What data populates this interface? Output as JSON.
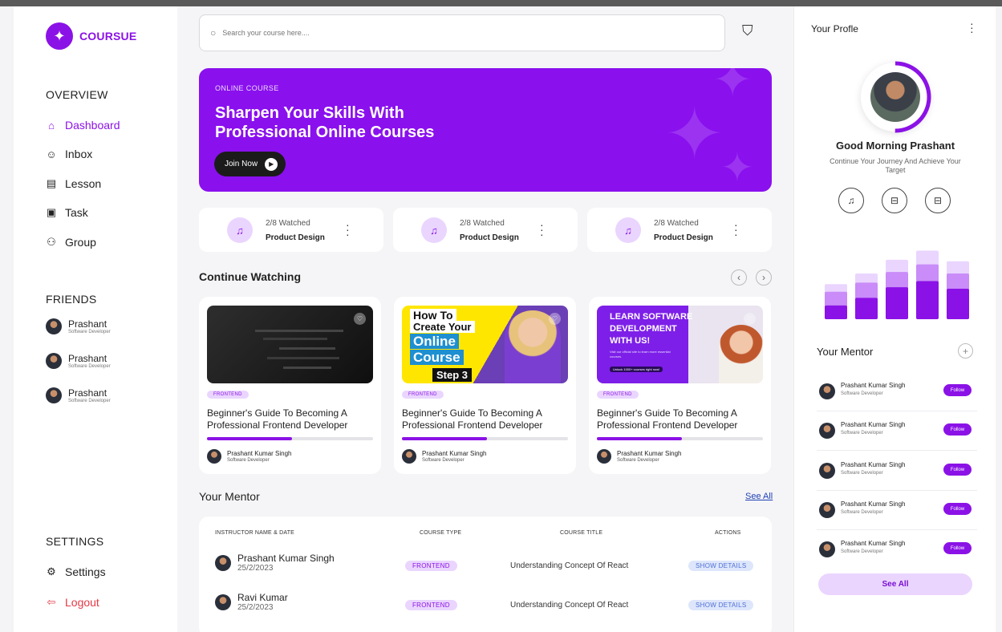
{
  "brand": {
    "name": "COURSUE",
    "accent": "#8b12e6"
  },
  "sidebar": {
    "overview_title": "OVERVIEW",
    "nav": [
      {
        "label": "Dashboard",
        "icon": "home-icon",
        "active": true
      },
      {
        "label": "Inbox",
        "icon": "inbox-icon"
      },
      {
        "label": "Lesson",
        "icon": "lesson-icon"
      },
      {
        "label": "Task",
        "icon": "task-icon"
      },
      {
        "label": "Group",
        "icon": "group-icon"
      }
    ],
    "friends_title": "FRIENDS",
    "friends": [
      {
        "name": "Prashant",
        "role": "Software Developer"
      },
      {
        "name": "Prashant",
        "role": "Software Developer"
      },
      {
        "name": "Prashant",
        "role": "Software Developer"
      }
    ],
    "settings_title": "SETTINGS",
    "settings_label": "Settings",
    "logout_label": "Logout"
  },
  "search": {
    "placeholder": "Search your course here...."
  },
  "hero": {
    "eyebrow": "ONLINE COURSE",
    "headline": "Sharpen  Your Skills With Professional Online Courses",
    "cta": "Join Now"
  },
  "stats": [
    {
      "watched": "2/8 Watched",
      "title": "Product Design"
    },
    {
      "watched": "2/8 Watched",
      "title": "Product Design"
    },
    {
      "watched": "2/8 Watched",
      "title": "Product Design"
    }
  ],
  "continue_watching": {
    "title": "Continue Watching",
    "cards": [
      {
        "tag": "FRONTEND",
        "title": "Beginner's Guide To Becoming A Professional Frontend Developer",
        "progress": 0.51,
        "author": "Prashant Kumar Singh",
        "role": "Software Developer",
        "thumb": "code"
      },
      {
        "tag": "FRONTEND",
        "title": "Beginner's Guide To Becoming A Professional Frontend Developer",
        "progress": 0.51,
        "author": "Prashant Kumar Singh",
        "role": "Software Developer",
        "thumb": "course",
        "thumb_text": [
          "How To",
          "Create Your",
          "Online",
          "Course",
          "Step 3"
        ]
      },
      {
        "tag": "FRONTEND",
        "title": "Beginner's Guide To Becoming A Professional Frontend Developer",
        "progress": 0.51,
        "author": "Prashant Kumar Singh",
        "role": "Software Developer",
        "thumb": "software",
        "thumb_text": [
          "LEARN SOFTWARE",
          "DEVELOPMENT",
          "WITH US!",
          "Visit our official site to learn more essential courses.",
          "Unlock 1000+ courses right now!"
        ]
      }
    ]
  },
  "mentor_table": {
    "title": "Your Mentor",
    "see_all": "See All",
    "headers": [
      "INSTRUCTOR NAME & DATE",
      "COURSE TYPE",
      "COURSE TITLE",
      "ACTIONS"
    ],
    "rows": [
      {
        "name": "Prashant Kumar Singh",
        "date": "25/2/2023",
        "type": "FRONTEND",
        "course": "Understanding Concept Of React",
        "action": "SHOW DETAILS"
      },
      {
        "name": "Ravi Kumar",
        "date": "25/2/2023",
        "type": "FRONTEND",
        "course": "Understanding Concept Of React",
        "action": "SHOW DETAILS"
      }
    ]
  },
  "profile": {
    "title": "Your Profle",
    "greeting": "Good Morning Prashant",
    "subtitle": "Continue Your Journey And Achieve Your Target",
    "actions": [
      "bell-icon",
      "inbox-icon",
      "inbox-icon"
    ],
    "chart_levels": [
      [
        0.18,
        0.36,
        0.46
      ],
      [
        0.28,
        0.48,
        0.6
      ],
      [
        0.42,
        0.62,
        0.78
      ],
      [
        0.5,
        0.72,
        0.9
      ],
      [
        0.4,
        0.6,
        0.76
      ]
    ]
  },
  "mentors": {
    "title": "Your Mentor",
    "items": [
      {
        "name": "Prashant Kumar Singh",
        "role": "Software Developer",
        "action": "Follow"
      },
      {
        "name": "Prashant Kumar Singh",
        "role": "Software Developer",
        "action": "Follow"
      },
      {
        "name": "Prashant Kumar Singh",
        "role": "Software Developer",
        "action": "Follow"
      },
      {
        "name": "Prashant Kumar Singh",
        "role": "Software Developer",
        "action": "Follow"
      },
      {
        "name": "Prashant Kumar Singh",
        "role": "Software Developer",
        "action": "Follow"
      }
    ],
    "see_all": "See All"
  }
}
